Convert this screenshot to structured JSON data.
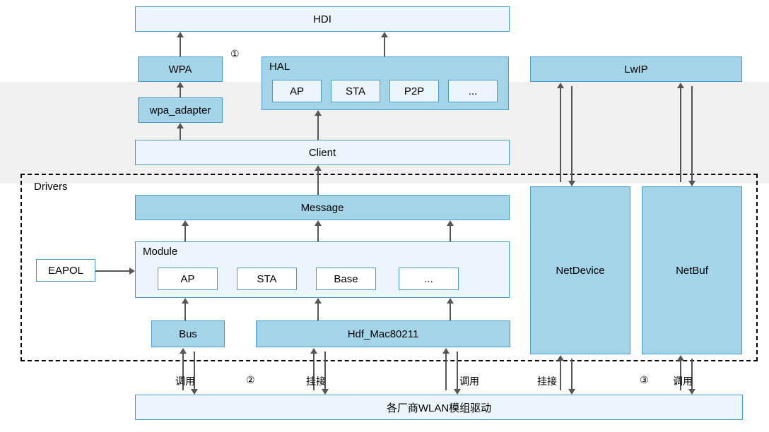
{
  "top": {
    "hdi": "HDI",
    "wpa": "WPA",
    "wpa_adapter": "wpa_adapter",
    "hal": {
      "title": "HAL",
      "items": [
        "AP",
        "STA",
        "P2P",
        "..."
      ]
    },
    "lwip": "LwIP",
    "client": "Client"
  },
  "drivers": {
    "title": "Drivers",
    "message": "Message",
    "eapol": "EAPOL",
    "module": {
      "title": "Module",
      "items": [
        "AP",
        "STA",
        "Base",
        "..."
      ]
    },
    "bus": "Bus",
    "hdf_mac": "Hdf_Mac80211",
    "netdevice": "NetDevice",
    "netbuf": "NetBuf"
  },
  "bottom": {
    "vendor": "各厂商WLAN模组驱动"
  },
  "annotations": {
    "call1": "调用",
    "hook1": "挂接",
    "call2": "调用",
    "hook2": "挂接",
    "call3": "调用",
    "num1": "①",
    "num2": "②",
    "num3": "③"
  }
}
